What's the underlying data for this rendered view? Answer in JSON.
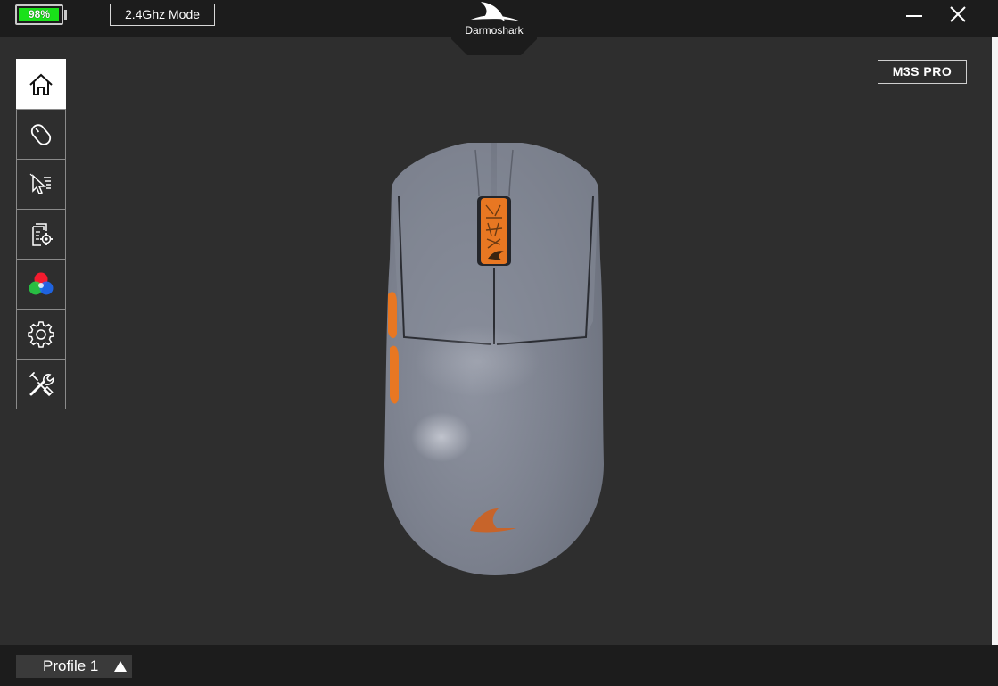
{
  "header": {
    "battery_text": "98%",
    "battery_level_percent": 98,
    "battery_color": "#19e119",
    "mode_label": "2.4Ghz Mode",
    "brand": "Darmoshark",
    "minimize_icon": "minimize-icon",
    "close_icon": "close-icon"
  },
  "device": {
    "model_label": "M3S PRO",
    "accent_color": "#e87722",
    "shell_color": "#7d8290"
  },
  "sidebar": {
    "items": [
      {
        "icon": "home-icon",
        "active": true
      },
      {
        "icon": "mouse-icon",
        "active": false
      },
      {
        "icon": "pointer-settings-icon",
        "active": false
      },
      {
        "icon": "document-gear-icon",
        "active": false
      },
      {
        "icon": "rgb-lighting-icon",
        "active": false
      },
      {
        "icon": "gear-icon",
        "active": false
      },
      {
        "icon": "tools-icon",
        "active": false
      }
    ]
  },
  "footer": {
    "profile_label": "Profile 1",
    "profile_arrow_icon": "triangle-up-icon"
  }
}
